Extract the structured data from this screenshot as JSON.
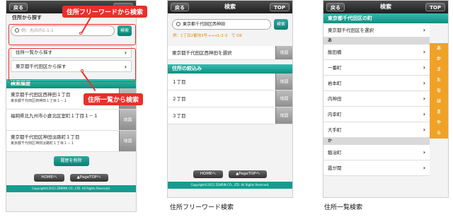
{
  "p1": {
    "header": {
      "back": "戻る",
      "top": "TOP"
    },
    "search_section": "住所から探す",
    "search": {
      "placeholder": "例：丸の内1-1-1",
      "button": "検索"
    },
    "list_items": [
      "住所一覧から探す",
      "東京都千代田区から探す"
    ],
    "history_section": "検索履歴",
    "history": [
      {
        "title": "東京都千代田区西神田１丁目",
        "sub": "東京都千代田区西神田１丁目１－１"
      },
      {
        "title": "福岡県北九州市小倉北区室町１丁目１－１",
        "sub": ""
      },
      {
        "title": "東京都千代田区神田淡路町１丁目",
        "sub": "東京都千代田区神田淡路町１丁目１－１"
      }
    ],
    "map_label": "地図",
    "delete_button": "履歴を削除",
    "footer": {
      "home": "HOMEへ",
      "pagetop": "▲PageTOPへ"
    },
    "copyright": "Copyright©2012 ZENRIN CO., LTD. All Rights Reserved.",
    "callouts": {
      "free": "住所フリーワードから検索",
      "list": "住所一覧から検索"
    }
  },
  "p2": {
    "header": {
      "back": "戻る",
      "title": "検索",
      "top": "TOP"
    },
    "search_value": "東京都千代田区西神田",
    "search_button": "検索",
    "hint": "例：1丁目2番地3号→→→1-2-3　で OK",
    "select_row": "東京都千代田区西神田を選択",
    "map_label": "地図",
    "narrow_section": "住所の絞込み",
    "choices": [
      "１丁目",
      "２丁目",
      "３丁目"
    ],
    "footer": {
      "home": "HOMEへ",
      "pagetop": "▲PageTOPへ"
    },
    "copyright": "Copyright©2012 ZENRIN CO., LTD. All Rights Reserved.",
    "caption": "住所フリーワード検索"
  },
  "p3": {
    "header": {
      "back": "戻る",
      "title": "検索",
      "top": "TOP"
    },
    "section": "東京都千代田区の町",
    "select_row": "東京都千代田区を選択",
    "group_a": "あ",
    "towns_a": [
      "飯田橋",
      "一番町",
      "岩本町",
      "内神田",
      "内幸町",
      "大手町"
    ],
    "group_ka": "か",
    "towns_ka": [
      "鍛冶町",
      "霞が関"
    ],
    "index": [
      "あ",
      "か",
      "さ",
      "た",
      "な",
      "は",
      "ま",
      "や",
      "ら"
    ],
    "caption": "住所一覧検索"
  }
}
